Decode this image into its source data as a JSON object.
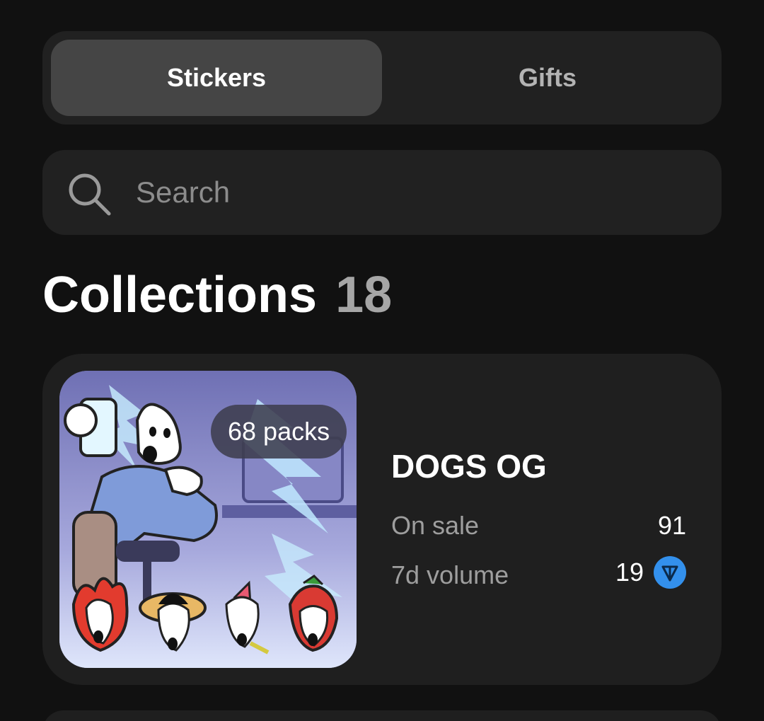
{
  "tabs": [
    {
      "label": "Stickers",
      "active": true
    },
    {
      "label": "Gifts",
      "active": false
    }
  ],
  "search": {
    "placeholder": "Search",
    "value": ""
  },
  "collections": {
    "title": "Collections",
    "count": "18"
  },
  "cards": [
    {
      "name": "DOGS OG",
      "packs_badge": "68 packs",
      "on_sale_label": "On sale",
      "on_sale_value": "91",
      "volume_label": "7d volume",
      "volume_value": "19",
      "currency_icon": "ton-icon"
    }
  ],
  "colors": {
    "background": "#111111",
    "surface": "#212121",
    "active_tab": "#454545",
    "muted_text": "#9e9e9e",
    "ton_blue": "#3390ec"
  }
}
